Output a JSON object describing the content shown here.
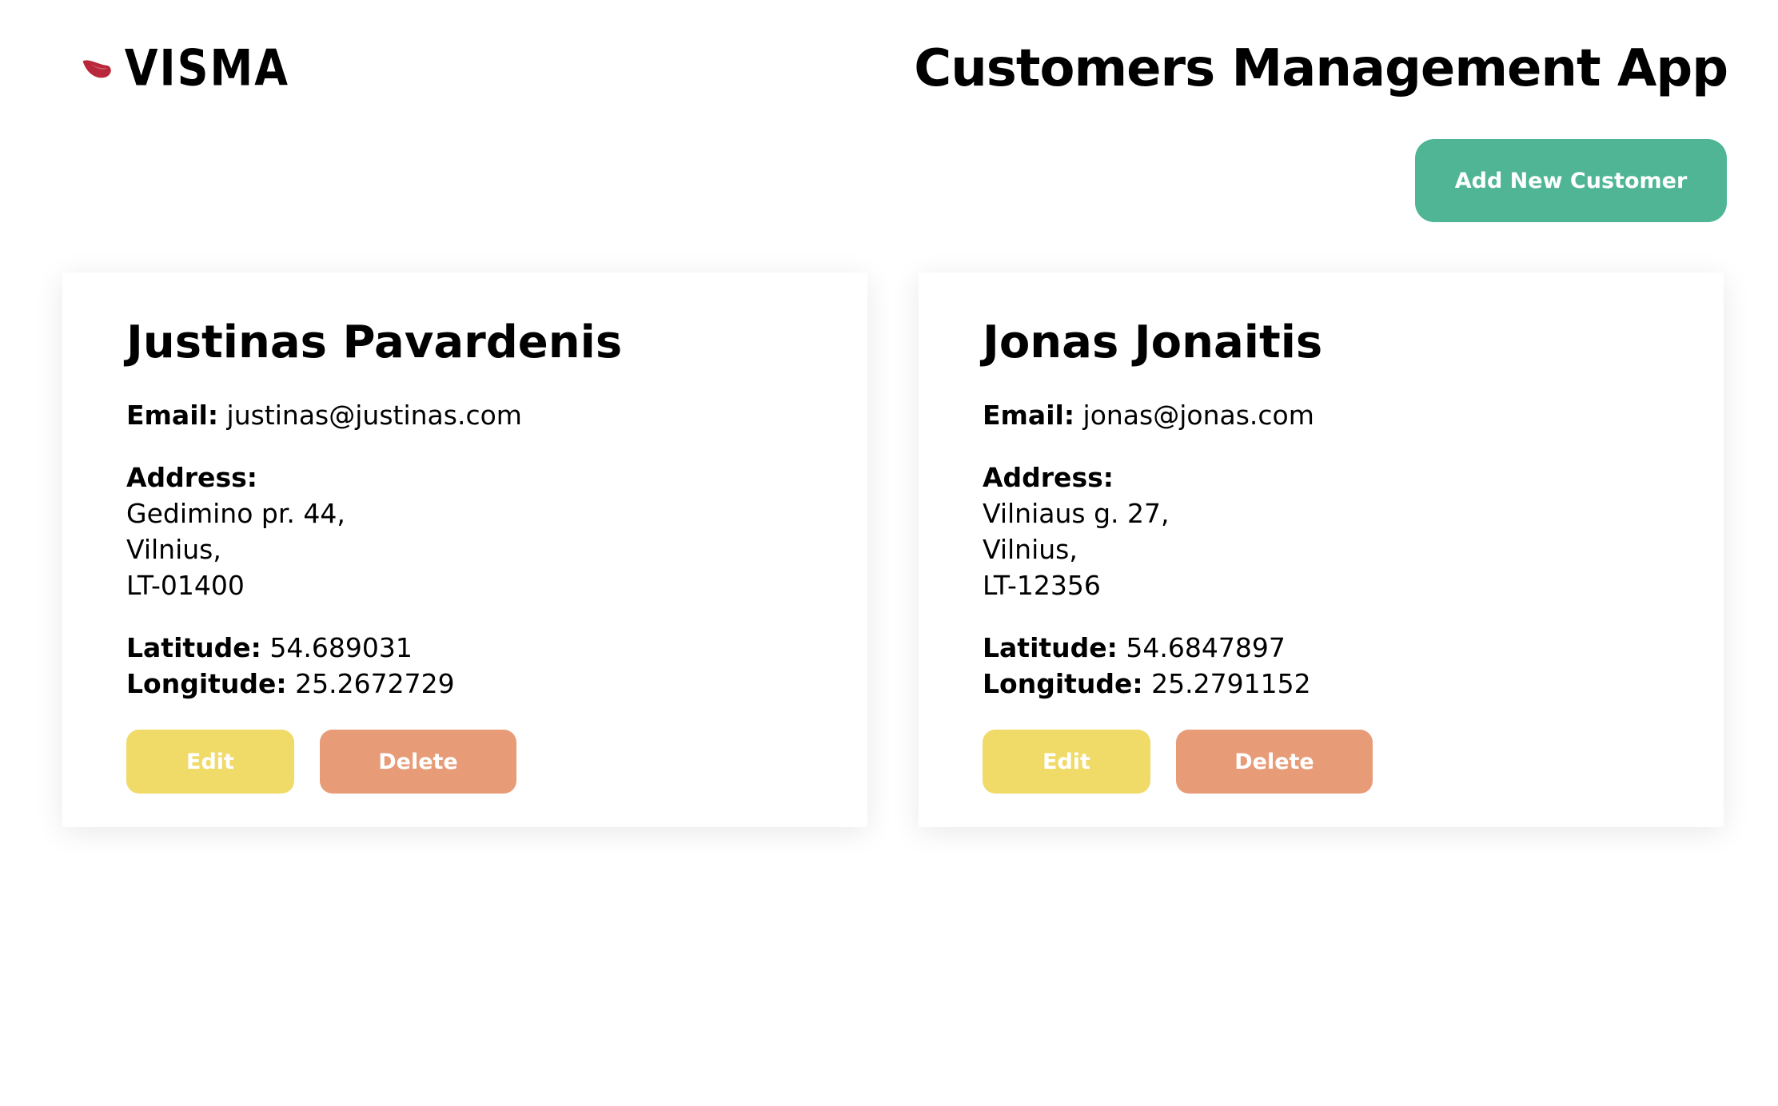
{
  "header": {
    "logo_text": "VISMA",
    "title": "Customers Management App",
    "add_button_label": "Add New Customer"
  },
  "labels": {
    "email": "Email:",
    "address": "Address:",
    "latitude": "Latitude:",
    "longitude": "Longitude:",
    "edit": "Edit",
    "delete": "Delete"
  },
  "customers": [
    {
      "name": "Justinas Pavardenis",
      "email": "justinas@justinas.com",
      "street": "Gedimino pr. 44,",
      "city": "Vilnius,",
      "postcode": "LT-01400",
      "latitude": "54.689031",
      "longitude": "25.2672729"
    },
    {
      "name": "Jonas Jonaitis",
      "email": "jonas@jonas.com",
      "street": "Vilniaus g. 27,",
      "city": "Vilnius,",
      "postcode": "LT-12356",
      "latitude": "54.6847897",
      "longitude": "25.2791152"
    }
  ],
  "colors": {
    "brand_logo": "#b8283a",
    "add_button": "#4fb594",
    "edit_button": "#f0da68",
    "delete_button": "#e89b77"
  }
}
